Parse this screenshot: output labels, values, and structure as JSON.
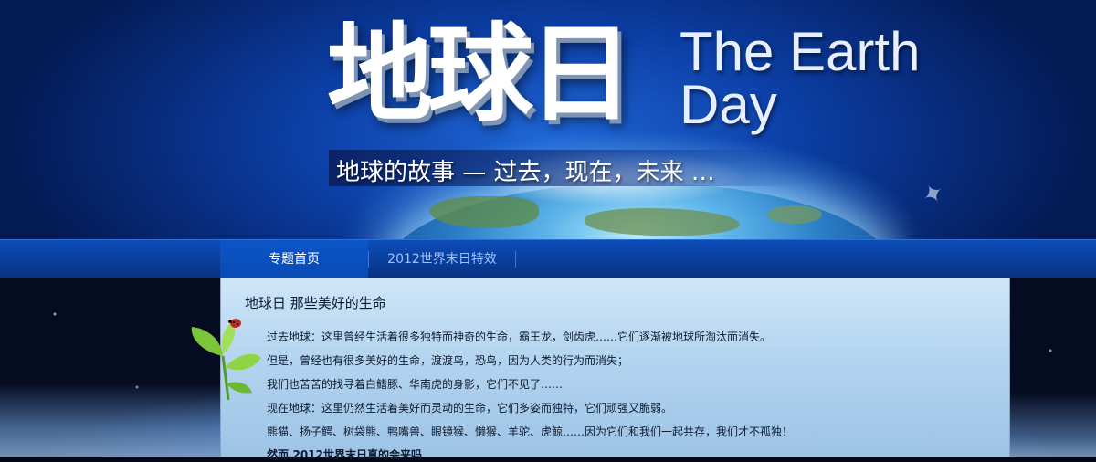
{
  "banner": {
    "title_cn": "地球日",
    "title_en_line1": "The Earth",
    "title_en_line2": "Day",
    "subtitle": "地球的故事 — 过去，现在，未来 …"
  },
  "nav": {
    "tabs": [
      {
        "label": "专题首页",
        "active": true
      },
      {
        "label": "2012世界末日特效",
        "active": false
      }
    ]
  },
  "content": {
    "heading": "地球日 那些美好的生命",
    "paragraphs": [
      "过去地球：这里曾经生活着很多独特而神奇的生命，霸王龙，剑齿虎……它们逐渐被地球所淘汰而消失。",
      "但是，曾经也有很多美好的生命，渡渡鸟，恐鸟，因为人类的行为而消失；",
      "我们也苦苦的找寻着白鳍豚、华南虎的身影，它们不见了……",
      "现在地球：这里仍然生活着美好而灵动的生命，它们多姿而独特，它们顽强又脆弱。",
      "熊猫、扬子鳄、树袋熊、鸭嘴兽、眼镜猴、懒猴、羊驼、虎鲸……因为它们和我们一起共存，我们才不孤独！",
      "然而,2012世界末日真的会来吗"
    ]
  },
  "colors": {
    "nav_active": "#0a55c8",
    "nav_inactive_text": "#9cc4ff",
    "content_bg": "#b6d6f0"
  },
  "icons": [
    "satellite-icon",
    "sprout-icon",
    "ladybug-icon"
  ]
}
